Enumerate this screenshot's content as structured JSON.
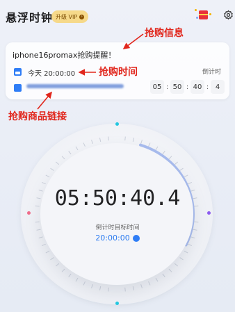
{
  "header": {
    "app_title": "悬浮时钟",
    "vip_label": "升级 VIP",
    "vip_arrow": "›"
  },
  "card": {
    "title": "iphone16promax抢购提醒！",
    "target_time": "今天 20:00:00",
    "countdown_label": "倒计时",
    "countdown": [
      "05",
      "50",
      "40",
      "4"
    ],
    "separator": ":"
  },
  "annotations": {
    "info": "抢购信息",
    "time": "抢购时间",
    "link": "抢购商品链接"
  },
  "clock": {
    "time": "05:50:40.4",
    "target_label": "倒计时目标时间",
    "target_value": "20:00:00"
  },
  "colors": {
    "accent": "#2f7df6",
    "annotation": "#e1261c",
    "vip": "#f6d98a",
    "progress_arc": "#a8bcef"
  },
  "icons": [
    "gift-icon",
    "settings-icon",
    "calendar-icon",
    "link-icon",
    "edit-icon",
    "chevron-right-icon"
  ]
}
